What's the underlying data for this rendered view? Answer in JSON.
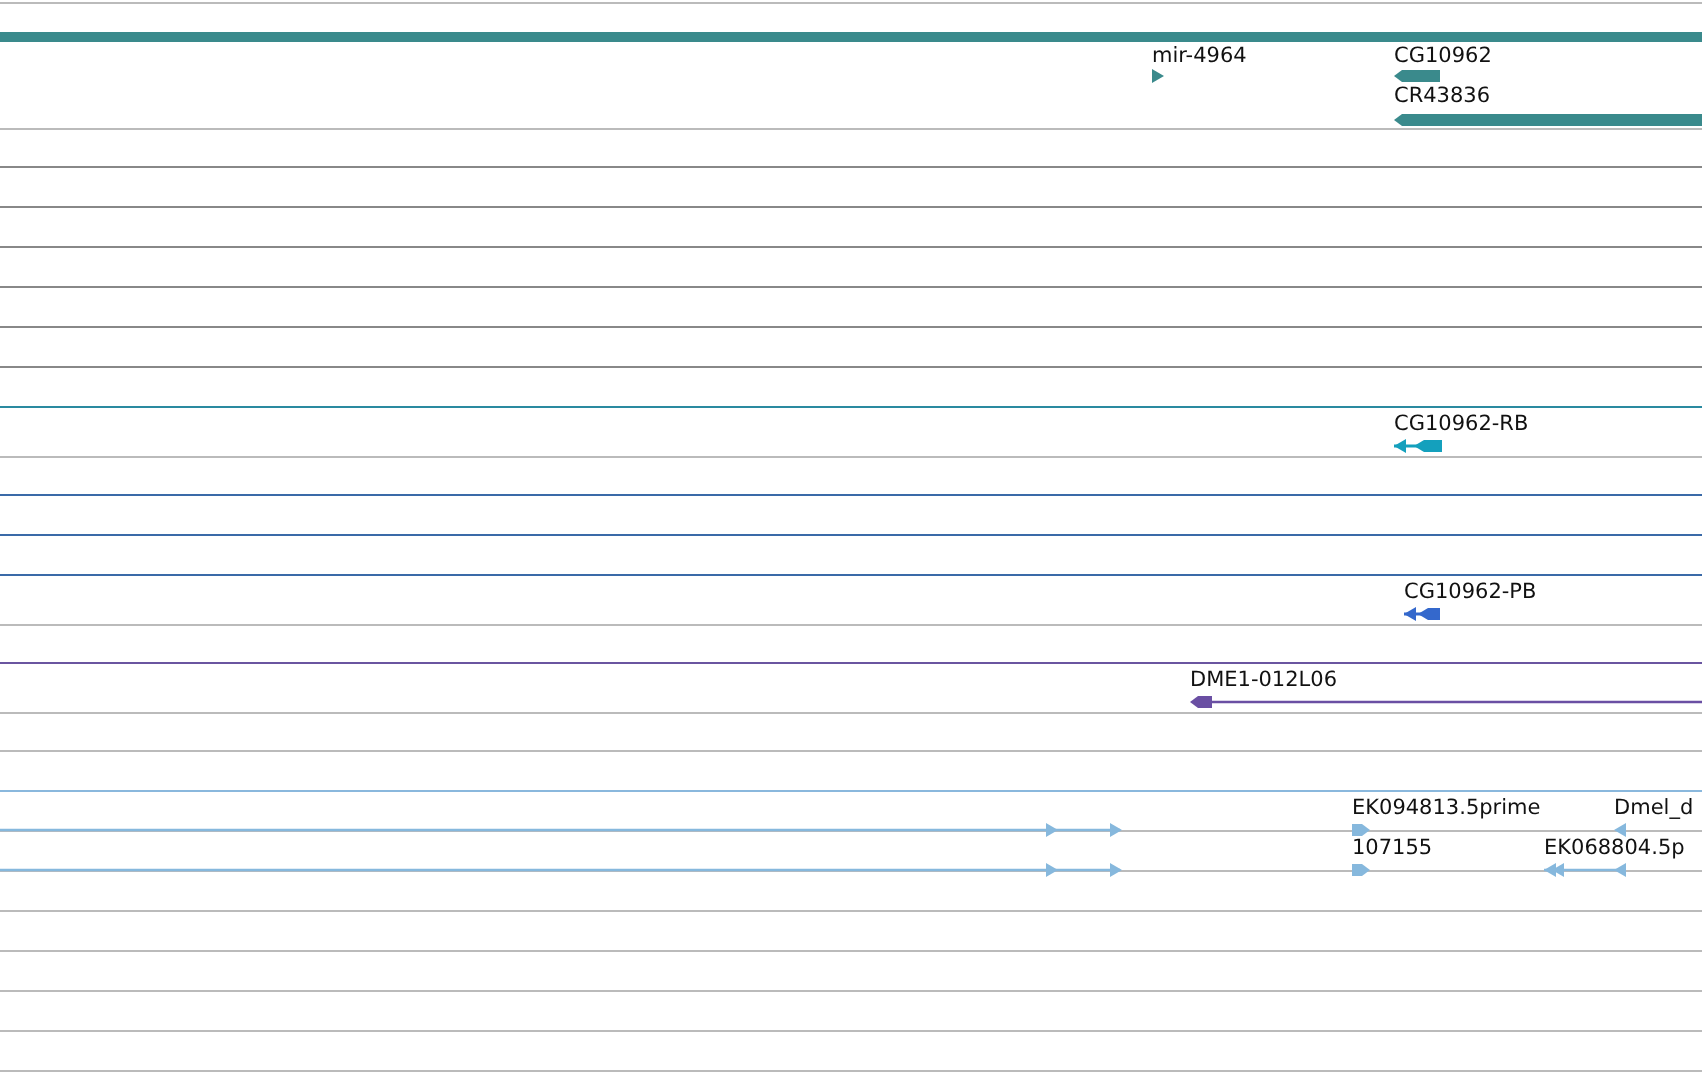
{
  "tracks": [
    {
      "features": [
        {
          "label": "mir-4964",
          "kind": "triangle",
          "reverse": false,
          "color": "#3a8a8c"
        },
        {
          "label": "CG10962",
          "kind": "block",
          "reverse": true,
          "color": "#3a8a8c"
        },
        {
          "label": "CR43836",
          "kind": "block",
          "reverse": true,
          "color": "#3a8a8c"
        }
      ]
    },
    {
      "features": [
        {
          "label": "CG10962-RB",
          "kind": "transcript",
          "reverse": true,
          "color": "#14a0bd"
        }
      ]
    },
    {
      "features": [
        {
          "label": "CG10962-PB",
          "kind": "transcript",
          "reverse": true,
          "color": "#3468cc"
        }
      ]
    },
    {
      "features": [
        {
          "label": "DME1-012L06",
          "kind": "block-line",
          "reverse": true,
          "color": "#6a4fa3"
        }
      ]
    },
    {
      "features": [
        {
          "kind": "span",
          "reverse": false,
          "color": "#86b8dd"
        },
        {
          "label": "EK094813.5prime",
          "kind": "block",
          "reverse": false,
          "color": "#86b8dd"
        },
        {
          "label": "Dmel_d",
          "kind": "triangle",
          "reverse": true,
          "color": "#86b8dd"
        }
      ]
    },
    {
      "features": [
        {
          "kind": "span",
          "reverse": false,
          "color": "#86b8dd"
        },
        {
          "label": "107155",
          "kind": "block",
          "reverse": false,
          "color": "#86b8dd"
        },
        {
          "label": "EK068804.5p",
          "kind": "span",
          "reverse": true,
          "color": "#86b8dd"
        }
      ]
    }
  ]
}
